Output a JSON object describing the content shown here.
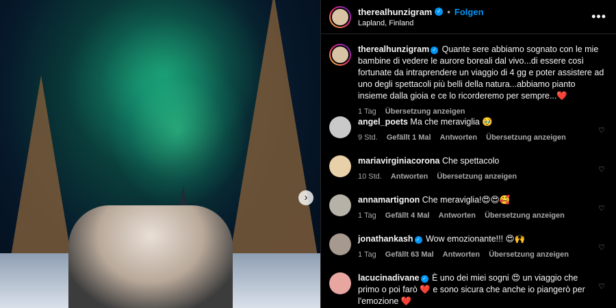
{
  "post": {
    "username": "therealhunzigram",
    "follow_label": "Folgen",
    "location": "Lapland, Finland",
    "more_label": "•••",
    "nav_next": "›"
  },
  "caption": {
    "username": "therealhunzigram",
    "text": "Quante sere abbiamo sognato con le mie bambine di vedere le aurore boreali dal vivo...di essere così fortunate da intraprendere un viaggio di 4 gg e poter assistere ad uno degli spettacoli più belli della natura...abbiamo pianto insieme dalla gioia e ce lo ricorderemo per sempre...❤️",
    "time": "1 Tag",
    "translate": "Übersetzung anzeigen"
  },
  "comments": [
    {
      "username": "angel_poets",
      "verified": false,
      "text": "Ma che meraviglia 🥹",
      "time": "9 Std.",
      "likes": "Gefällt 1 Mal",
      "reply": "Antworten",
      "translate": "Übersetzung anzeigen",
      "avatar_color": "#c9c9c9"
    },
    {
      "username": "mariavirginiacorona",
      "verified": false,
      "text": "Che spettacolo",
      "time": "10 Std.",
      "likes": "",
      "reply": "Antworten",
      "translate": "Übersetzung anzeigen",
      "avatar_color": "#e8d0a9"
    },
    {
      "username": "annamartignon",
      "verified": false,
      "text": "Che meraviglia!😍😍🥰",
      "time": "1 Tag",
      "likes": "Gefällt 4 Mal",
      "reply": "Antworten",
      "translate": "Übersetzung anzeigen",
      "avatar_color": "#b7b2a8"
    },
    {
      "username": "jonathankash",
      "verified": true,
      "text": "Wow emozionante!!! 😍🙌",
      "time": "1 Tag",
      "likes": "Gefällt 63 Mal",
      "reply": "Antworten",
      "translate": "Übersetzung anzeigen",
      "avatar_color": "#a69a8f"
    },
    {
      "username": "lacucinadivane",
      "verified": true,
      "text": "È uno dei miei sogni 😍 un viaggio che primo o poi farò ❤️ e sono sicura che anche io piangerò per l'emozione ❤️",
      "time": "",
      "likes": "",
      "reply": "",
      "translate": "",
      "avatar_color": "#e7a6a0"
    }
  ],
  "colors": {
    "accent": "#0095f6",
    "background": "#000000",
    "muted": "#a8a8a8"
  }
}
